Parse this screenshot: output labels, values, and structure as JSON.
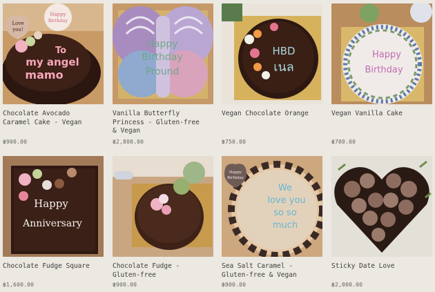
{
  "products": [
    {
      "name": "Chocolate Avocado\nCaramel Cake - Vegan",
      "price": "฿900.00",
      "cake_text": [
        "To",
        "my angel",
        "mamo"
      ],
      "topper_text": [
        "Happy",
        "Birthday"
      ],
      "heart_text": [
        "Love",
        "you!"
      ]
    },
    {
      "name": "Vanilla Butterfly\nPrincess - Gluten-free\n& Vegan",
      "price": "฿2,800.00",
      "cake_text": [
        "Happy",
        "Birthday",
        "Pround"
      ]
    },
    {
      "name": "Vegan Chocolate Orange",
      "price": "฿750.00",
      "cake_text": [
        "HBD",
        "เนล"
      ]
    },
    {
      "name": "Vegan Vanilla Cake",
      "price": "฿700.00",
      "cake_text": [
        "Happy",
        "Birthday"
      ]
    },
    {
      "name": "Chocolate Fudge Square",
      "price": "฿1,600.00",
      "cake_text": [
        "Happy",
        "Anniversary"
      ]
    },
    {
      "name": "Chocolate Fudge -\nGluten-free",
      "price": "฿900.00"
    },
    {
      "name": "Sea Salt Caramel -\nGluten-free & Vegan",
      "price": "฿900.00",
      "cake_text": [
        "We",
        "love you",
        "so so",
        "much"
      ],
      "topper_text": [
        "Happy",
        "Birthday"
      ]
    },
    {
      "name": "Sticky Date Love",
      "price": "฿2,000.00"
    }
  ]
}
